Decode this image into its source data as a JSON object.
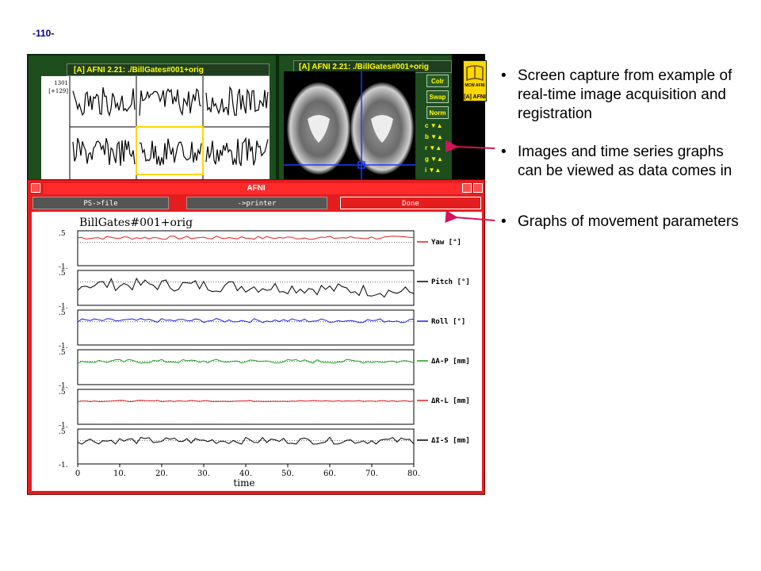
{
  "slide_number": "-110-",
  "window_top_left": {
    "title": "[A] AFNI 2.21: ./BillGates#001+orig",
    "graph_label_1": "1301",
    "graph_label_2": "[+129]"
  },
  "window_top_right": {
    "title": "[A] AFNI 2.21: ./BillGates#001+orig",
    "buttons": [
      "Colr",
      "Swap",
      "Norm"
    ],
    "rows": [
      "c",
      "b",
      "r",
      "g",
      "i"
    ],
    "logo_text": "MCW AFNI",
    "logo_sub": "[A] AFNI"
  },
  "plot_window": {
    "title": "AFNI",
    "buttons": {
      "ps_file": "PS->file",
      "printer": "->printer",
      "done": "Done"
    },
    "dataset_title": "BillGates#001+orig",
    "xlabel": "time",
    "x_ticks": [
      "0",
      "10.",
      "20.",
      "30.",
      "40.",
      "50.",
      "60.",
      "70.",
      "80."
    ],
    "y_tick_top": ".5",
    "y_tick_bottom": "-1."
  },
  "chart_data": {
    "type": "line",
    "title": "BillGates#001+orig",
    "xlabel": "time",
    "xlim": [
      0,
      80
    ],
    "ylim": [
      -1,
      0.5
    ],
    "series": [
      {
        "name": "Yaw [°]",
        "color": "#e41e1e",
        "baseline": 0.2,
        "amplitude": 0.12
      },
      {
        "name": "Pitch [°]",
        "color": "#000000",
        "baseline": -0.1,
        "amplitude": 0.45
      },
      {
        "name": "Roll [°]",
        "color": "#1e1ee4",
        "baseline": 0.05,
        "amplitude": 0.15
      },
      {
        "name": "ΔA-P [mm]",
        "color": "#1ea01e",
        "baseline": 0.0,
        "amplitude": 0.15
      },
      {
        "name": "ΔR-L [mm]",
        "color": "#e41e1e",
        "baseline": 0.0,
        "amplitude": 0.05
      },
      {
        "name": "ΔI-S [mm]",
        "color": "#000000",
        "baseline": 0.0,
        "amplitude": 0.25
      }
    ]
  },
  "bullets": [
    {
      "text": "Screen capture from example of real-time image acquisition and registration"
    },
    {
      "text": "Images and time series graphs can be viewed as data comes in"
    },
    {
      "text": "Graphs of movement parameters"
    }
  ],
  "colors": {
    "afni_green": "#1e4d1e",
    "afni_yellow": "#ffff00",
    "afni_red": "#e41e1e",
    "arrow": "#d4145a"
  }
}
